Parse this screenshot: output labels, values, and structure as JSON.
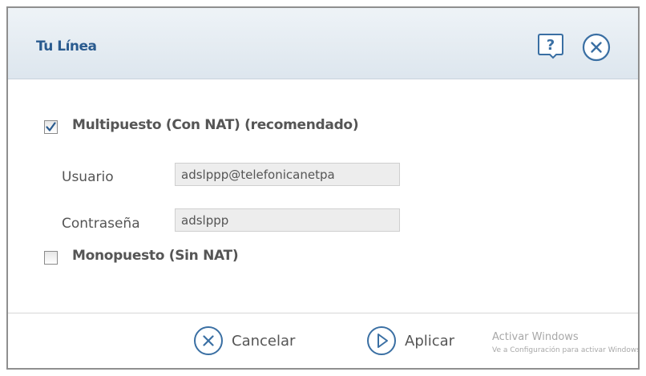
{
  "dialog": {
    "title": "Tu Línea",
    "icons": {
      "help": "help-icon",
      "close": "close-icon"
    }
  },
  "options": {
    "multi": {
      "label": "Multipuesto (Con NAT) (recomendado)",
      "checked": true
    },
    "mono": {
      "label": "Monopuesto (Sin NAT)",
      "checked": false
    }
  },
  "fields": {
    "user": {
      "label": "Usuario",
      "value": "adslppp@telefonicanetpa"
    },
    "password": {
      "label": "Contraseña",
      "value": "adslppp"
    }
  },
  "footer": {
    "cancel_label": "Cancelar",
    "apply_label": "Aplicar",
    "icons": {
      "cancel": "cancel-icon",
      "apply": "apply-icon"
    }
  },
  "watermark": {
    "title": "Activar Windows",
    "subtitle": "Ve a Configuración para activar Windows"
  },
  "colors": {
    "title": "#2a5b8f",
    "icon_blue": "#3a6fa3",
    "header_top": "#eef3f7",
    "header_bottom": "#dde6ee",
    "text": "#555555",
    "field_bg": "#ededed"
  }
}
